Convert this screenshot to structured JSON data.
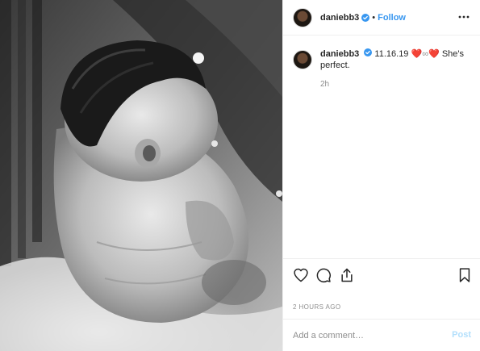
{
  "post": {
    "username": "daniebb3",
    "follow_label": "Follow",
    "separator": "•",
    "more_icon": "more-horizontal-icon",
    "verified_icon": "verified-badge-icon",
    "verified_color": "#3897f0"
  },
  "caption": {
    "username": "daniebb3",
    "date": "11.16.19",
    "heart_left": "❤️",
    "infinity": "∞",
    "heart_right": "❤️",
    "text": "She's perfect.",
    "time_ago": "2h"
  },
  "actions": {
    "like_icon": "heart-outline-icon",
    "comment_icon": "comment-bubble-icon",
    "share_icon": "share-upload-icon",
    "save_icon": "bookmark-icon"
  },
  "timestamp": "2 HOURS AGO",
  "comment": {
    "placeholder": "Add a comment…",
    "post_label": "Post",
    "post_color": "#b2dffc"
  }
}
